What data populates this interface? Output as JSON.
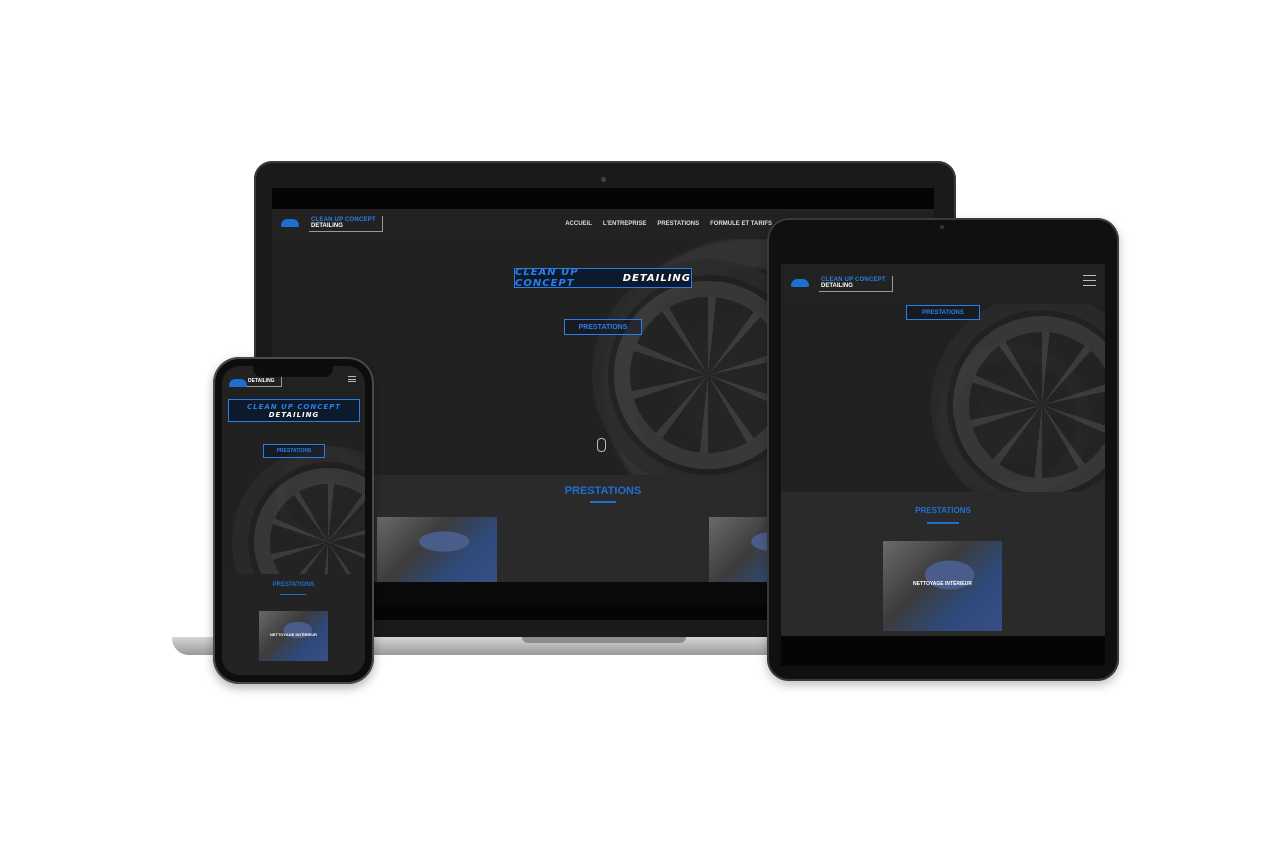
{
  "site": {
    "brand_top": "CLEAN UP CONCEPT",
    "brand_bottom": "DETAILING",
    "hero_title_blue": "CLEAN UP CONCEPT",
    "hero_title_white": "DETAILING",
    "cta_label": "PRESTATIONS",
    "section_title": "PRESTATIONS",
    "service_1": "NETTOYAGE INTÉRIEUR"
  },
  "laptop_nav": [
    "ACCUEIL",
    "L'ENTREPRISE",
    "PRESTATIONS",
    "FORMULE ET TARIFS"
  ],
  "icons": {
    "logo": "car-logo-icon",
    "menu": "hamburger-menu-icon",
    "scroll": "scroll-mouse-icon"
  },
  "colors": {
    "accent": "#2a7ee8",
    "header_bg": "#222222",
    "section_bg": "#2a2a2a"
  }
}
